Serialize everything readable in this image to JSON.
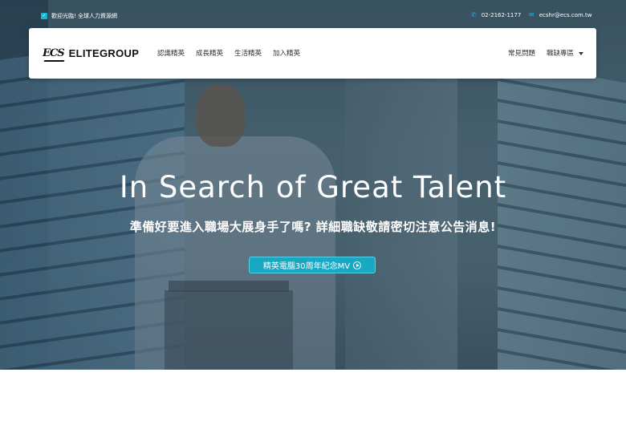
{
  "topbar": {
    "welcome_text": "歡迎光臨! 全球人力資源網",
    "phone": "02-2162-1177",
    "email": "ecshr@ecs.com.tw"
  },
  "nav": {
    "logo_mark": "ECS",
    "logo_text": "ELITEGROUP",
    "links": [
      "認識精英",
      "成長精英",
      "生活精英",
      "加入精英"
    ],
    "faq": "常見問題",
    "jobs": "職缺專區"
  },
  "hero": {
    "title": "In Search of Great Talent",
    "subtitle": "準備好要進入職場大展身手了嗎? 詳細職缺敬請密切注意公告消息!",
    "cta_label": "精英電腦30周年紀念MV"
  },
  "colors": {
    "accent": "#17a8c4",
    "navbar_bg": "#ffffff",
    "page_bg": "#ffffff"
  },
  "icons": [
    "check-icon",
    "phone-icon",
    "mail-icon",
    "caret-down-icon",
    "play-circle-icon"
  ]
}
